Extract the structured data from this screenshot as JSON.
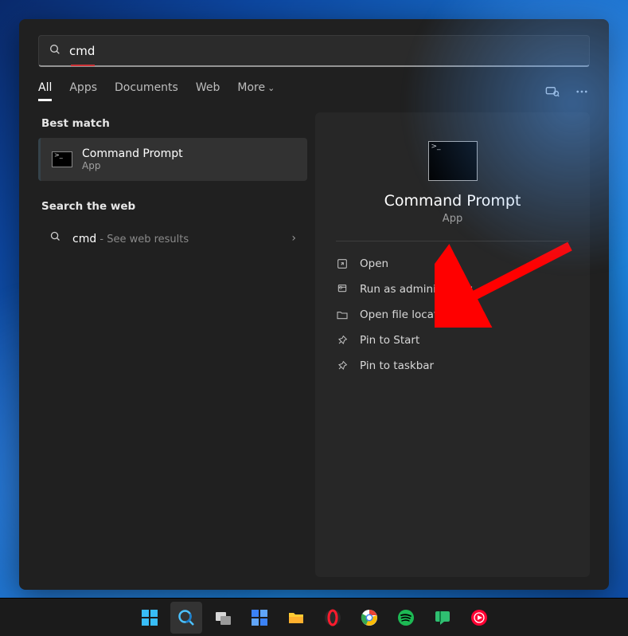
{
  "search": {
    "value": "cmd"
  },
  "tabs": {
    "items": [
      "All",
      "Apps",
      "Documents",
      "Web",
      "More"
    ],
    "active_index": 0
  },
  "left": {
    "best_match_label": "Best match",
    "best": {
      "title": "Command Prompt",
      "subtitle": "App"
    },
    "web_label": "Search the web",
    "web": {
      "query": "cmd",
      "hint": " - See web results"
    }
  },
  "preview": {
    "title": "Command Prompt",
    "subtitle": "App",
    "actions": [
      {
        "icon": "open",
        "label": "Open"
      },
      {
        "icon": "admin",
        "label": "Run as administrator"
      },
      {
        "icon": "folder",
        "label": "Open file location"
      },
      {
        "icon": "pin",
        "label": "Pin to Start"
      },
      {
        "icon": "pin",
        "label": "Pin to taskbar"
      }
    ]
  },
  "taskbar": {
    "items": [
      {
        "name": "start"
      },
      {
        "name": "search",
        "active": true
      },
      {
        "name": "task-view"
      },
      {
        "name": "widgets"
      },
      {
        "name": "file-explorer"
      },
      {
        "name": "opera"
      },
      {
        "name": "chrome"
      },
      {
        "name": "spotify"
      },
      {
        "name": "chat"
      },
      {
        "name": "youtube-music"
      }
    ]
  }
}
